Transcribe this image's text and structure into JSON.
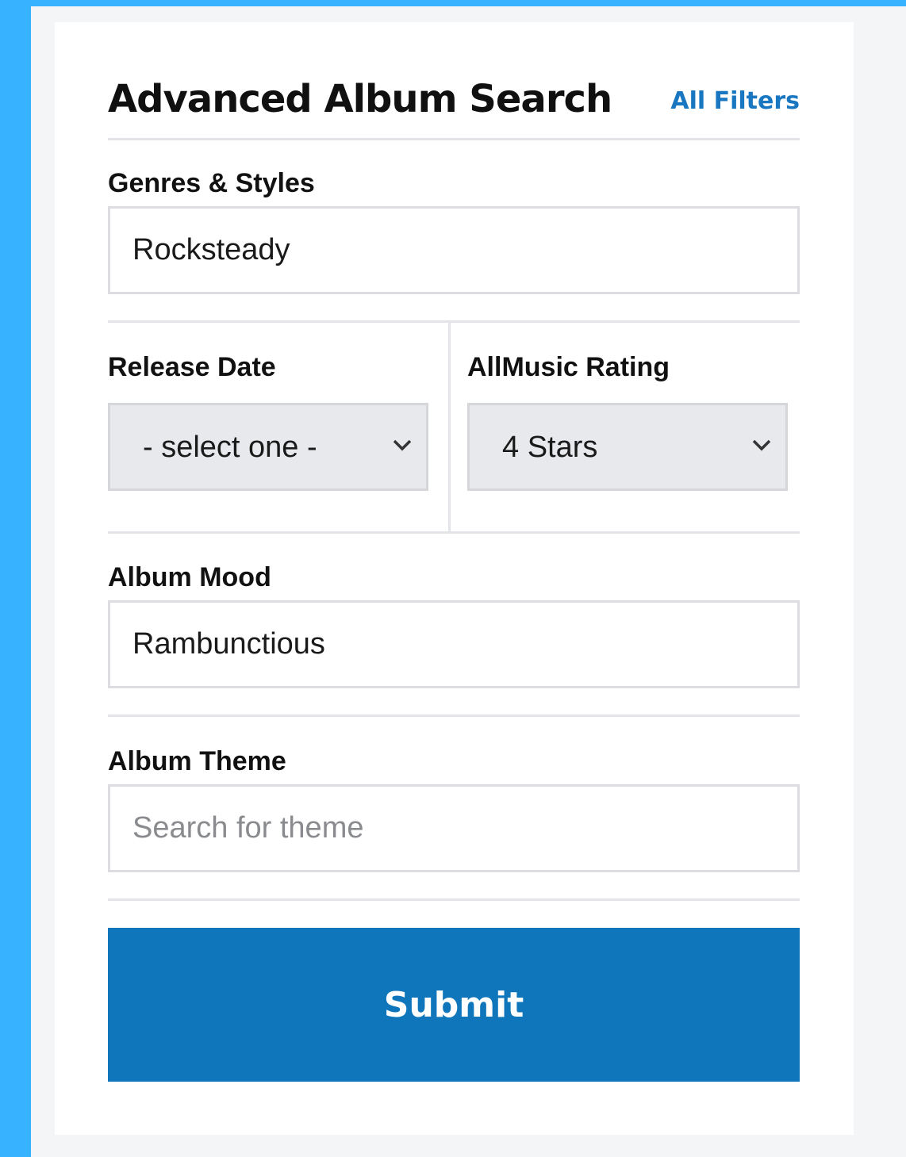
{
  "header": {
    "title": "Advanced Album Search",
    "all_filters_link": "All Filters"
  },
  "genres": {
    "label": "Genres & Styles",
    "value": "Rocksteady"
  },
  "release_date": {
    "label": "Release Date",
    "selected": "- select one -"
  },
  "rating": {
    "label": "AllMusic Rating",
    "selected": "4 Stars"
  },
  "mood": {
    "label": "Album Mood",
    "value": "Rambunctious"
  },
  "theme": {
    "label": "Album Theme",
    "value": "",
    "placeholder": "Search for theme"
  },
  "submit": {
    "label": "Submit"
  },
  "colors": {
    "frame": "#36b2ff",
    "accent": "#1076bc",
    "link": "#1976c1"
  },
  "icons": {
    "release_date_chevron": "chevron-down-icon",
    "rating_chevron": "chevron-down-icon"
  }
}
